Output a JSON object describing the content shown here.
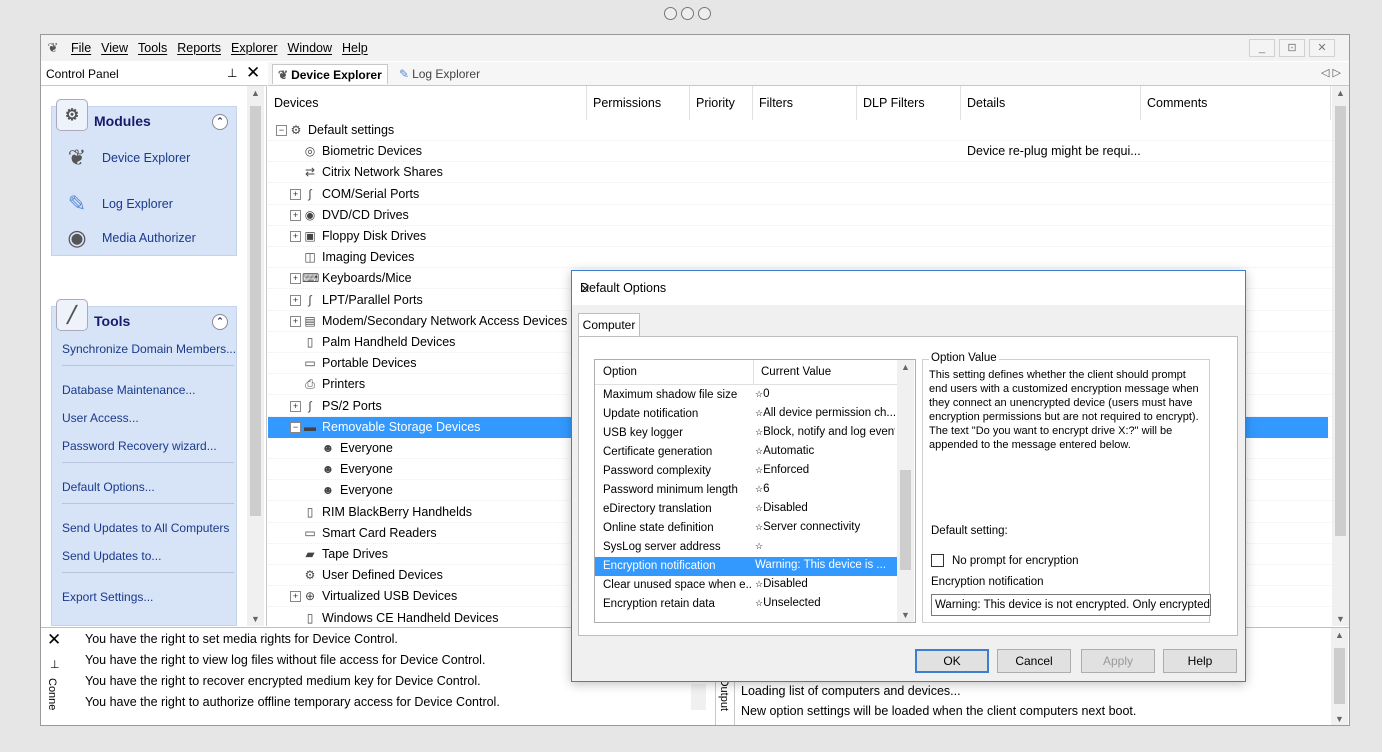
{
  "menubar": {
    "items": [
      "File",
      "View",
      "Tools",
      "Reports",
      "Explorer",
      "Window",
      "Help"
    ],
    "window_controls": [
      "_",
      "⊡",
      "✕"
    ]
  },
  "control_panel": {
    "title": "Control Panel",
    "modules": {
      "title": "Modules",
      "items": [
        "Device Explorer",
        "Log Explorer",
        "Media Authorizer"
      ]
    },
    "tools": {
      "title": "Tools",
      "links": [
        "Synchronize Domain Members...",
        "Database Maintenance...",
        "User Access...",
        "Password Recovery wizard...",
        "Default Options...",
        "Send Updates to All Computers",
        "Send Updates to...",
        "Export Settings..."
      ]
    }
  },
  "tabs": [
    "Device Explorer",
    "Log Explorer"
  ],
  "columns": [
    "Devices",
    "Permissions",
    "Priority",
    "Filters",
    "DLP Filters",
    "Details",
    "Comments"
  ],
  "tree": [
    {
      "label": "Default settings",
      "level": 0,
      "expander": "−",
      "icon": "settings-icon"
    },
    {
      "label": "Biometric Devices",
      "level": 1,
      "expander": "",
      "icon": "fingerprint-icon",
      "details": "Device re-plug might be requi..."
    },
    {
      "label": "Citrix Network Shares",
      "level": 1,
      "expander": "",
      "icon": "network-share-icon"
    },
    {
      "label": "COM/Serial Ports",
      "level": 1,
      "expander": "+",
      "icon": "serial-port-icon"
    },
    {
      "label": "DVD/CD Drives",
      "level": 1,
      "expander": "+",
      "icon": "disc-icon"
    },
    {
      "label": "Floppy Disk Drives",
      "level": 1,
      "expander": "+",
      "icon": "floppy-icon"
    },
    {
      "label": "Imaging Devices",
      "level": 1,
      "expander": "",
      "icon": "camera-icon"
    },
    {
      "label": "Keyboards/Mice",
      "level": 1,
      "expander": "+",
      "icon": "keyboard-icon"
    },
    {
      "label": "LPT/Parallel Ports",
      "level": 1,
      "expander": "+",
      "icon": "parallel-port-icon"
    },
    {
      "label": "Modem/Secondary Network Access Devices",
      "level": 1,
      "expander": "+",
      "icon": "modem-icon"
    },
    {
      "label": "Palm Handheld Devices",
      "level": 1,
      "expander": "",
      "icon": "handheld-icon"
    },
    {
      "label": "Portable Devices",
      "level": 1,
      "expander": "",
      "icon": "portable-device-icon"
    },
    {
      "label": "Printers",
      "level": 1,
      "expander": "",
      "icon": "printer-icon"
    },
    {
      "label": "PS/2 Ports",
      "level": 1,
      "expander": "+",
      "icon": "ps2-port-icon"
    },
    {
      "label": "Removable Storage Devices",
      "level": 1,
      "expander": "−",
      "icon": "usb-drive-icon",
      "selected": true
    },
    {
      "label": "Everyone",
      "level": 2,
      "expander": "",
      "icon": "users-icon"
    },
    {
      "label": "Everyone",
      "level": 2,
      "expander": "",
      "icon": "users-icon"
    },
    {
      "label": "Everyone",
      "level": 2,
      "expander": "",
      "icon": "users-icon"
    },
    {
      "label": "RIM BlackBerry Handhelds",
      "level": 1,
      "expander": "",
      "icon": "blackberry-icon"
    },
    {
      "label": "Smart Card Readers",
      "level": 1,
      "expander": "",
      "icon": "smart-card-icon"
    },
    {
      "label": "Tape Drives",
      "level": 1,
      "expander": "",
      "icon": "tape-icon"
    },
    {
      "label": "User Defined Devices",
      "level": 1,
      "expander": "",
      "icon": "custom-device-icon"
    },
    {
      "label": "Virtualized USB Devices",
      "level": 1,
      "expander": "+",
      "icon": "virtual-usb-icon"
    },
    {
      "label": "Windows CE Handheld Devices",
      "level": 1,
      "expander": "",
      "icon": "handheld-icon"
    }
  ],
  "rights_messages": [
    "You have the right to set media rights for Device Control.",
    "You have the right to view log files without file access for Device Control.",
    "You have the right to recover encrypted medium key for Device Control.",
    "You have the right to authorize offline temporary access for Device Control."
  ],
  "rights_panel_side_label": "Conne",
  "output": {
    "side_label": "Output",
    "lines": [
      "Loading list of computers and devices...",
      "New option settings will be loaded when the client computers next boot."
    ]
  },
  "dialog": {
    "title": "Default Options",
    "tab": "Computer",
    "list_headers": [
      "Option",
      "Current Value"
    ],
    "options": [
      {
        "name": "Maximum shadow file size",
        "value": "0"
      },
      {
        "name": "Update notification",
        "value": "All device permission ch..."
      },
      {
        "name": "USB key logger",
        "value": "Block, notify and log event"
      },
      {
        "name": "Certificate generation",
        "value": "Automatic"
      },
      {
        "name": "Password complexity",
        "value": "Enforced"
      },
      {
        "name": "Password minimum length",
        "value": "6"
      },
      {
        "name": "eDirectory translation",
        "value": "Disabled"
      },
      {
        "name": "Online state definition",
        "value": "Server connectivity"
      },
      {
        "name": "SysLog server address",
        "value": ""
      },
      {
        "name": "Encryption notification",
        "value": "Warning: This device is ...",
        "selected": true
      },
      {
        "name": "Clear unused space when e...",
        "value": "Disabled"
      },
      {
        "name": "Encryption retain data",
        "value": "Unselected"
      },
      {
        "name": "",
        "value": ""
      }
    ],
    "option_value_title": "Option Value",
    "description": "This setting defines whether the client should prompt end users with a customized encryption message when they connect an unencrypted device (users must have encryption permissions but are not required to encrypt). The text \"Do you want to encrypt drive X:?\" will be appended to the message entered below.",
    "default_setting_label": "Default setting:",
    "checkbox_label": "No prompt for encryption",
    "checkbox_checked": false,
    "field_label": "Encryption notification",
    "field_value": "Warning: This device is not encrypted.  Only encrypted d",
    "buttons": {
      "ok": "OK",
      "cancel": "Cancel",
      "apply": "Apply",
      "help": "Help"
    }
  },
  "colors": {
    "selection": "#3399ff",
    "panel_group": "#d7e3f7",
    "link": "#1a3a8a",
    "dialog_border": "#3c7fd0"
  }
}
